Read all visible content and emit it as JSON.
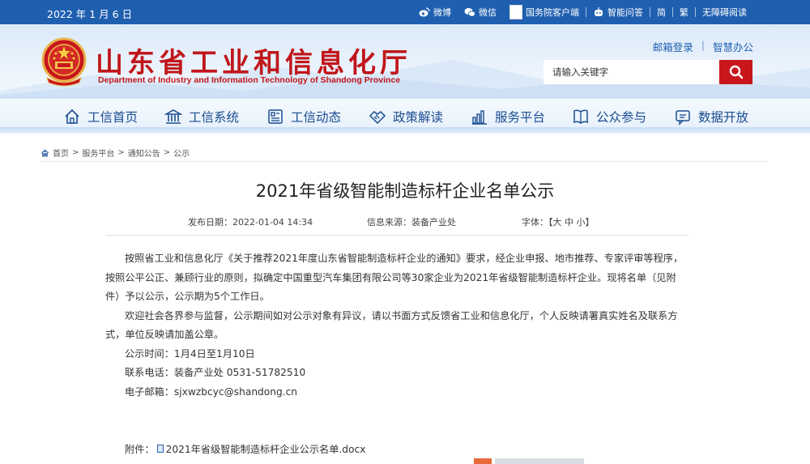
{
  "topbar": {
    "date": "2022 年 1 月 6 日",
    "links": [
      "微博",
      "微信",
      "国务院客户端",
      "智能问答",
      "简",
      "繁",
      "无障碍阅读"
    ]
  },
  "header": {
    "site_title_cn": "山东省工业和信息化厅",
    "site_title_en": "Department of Industry and Information Technology of Shandong Province",
    "mail_login": "邮箱登录",
    "smart_office": "智慧办公",
    "search_placeholder": "请输入关键字"
  },
  "nav": [
    "工信首页",
    "工信系统",
    "工信动态",
    "政策解读",
    "服务平台",
    "公众参与",
    "数据开放"
  ],
  "breadcrumb": [
    "首页",
    ">",
    "服务平台",
    ">",
    "通知公告",
    ">",
    "公示"
  ],
  "article": {
    "title": "2021年省级智能制造标杆企业名单公示",
    "publish_date": "发布日期：2022-01-04 14:34",
    "source": "信息来源：装备产业处",
    "font_label": "字体：【",
    "font_large": "大",
    "font_medium": "中",
    "font_small": "小",
    "font_end": "】",
    "paragraphs": [
      "按照省工业和信息化厅《关于推荐2021年度山东省智能制造标杆企业的通知》要求，经企业申报、地市推荐、专家评审等程序，按照公平公正、兼顾行业的原则，拟确定中国重型汽车集团有限公司等30家企业为2021年省级智能制造标杆企业。现将名单（见附件）予以公示，公示期为5个工作日。",
      "欢迎社会各界参与监督，公示期间如对公示对象有异议，请以书面方式反馈省工业和信息化厅，个人反映请署真实姓名及联系方式，单位反映请加盖公章。",
      "公示时间：1月4日至1月10日",
      "联系电话：装备产业处 0531-51782510",
      "电子邮箱：sjxwzbcyc@shandong.cn"
    ],
    "attachment_label": "附件：",
    "attachment_file": "2021年省级智能制造标杆企业公示名单.docx"
  },
  "colors": {
    "topbar": "#1f5fb0",
    "brand_red": "#c0161b",
    "search_btn": "#c9161d",
    "nav_text": "#1a4c90"
  }
}
